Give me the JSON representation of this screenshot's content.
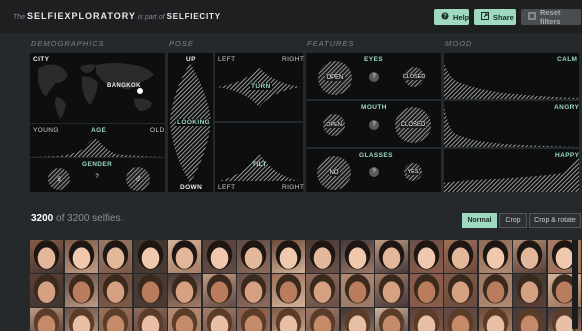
{
  "app": {
    "prefix": "The",
    "name": "SELFIEXPLORATORY",
    "part_of": "is part of",
    "city": "SELFIECITY"
  },
  "toolbar": {
    "help": "Help",
    "share": "Share",
    "reset": "Reset filters",
    "help_icon": "question-circle-icon",
    "share_icon": "share-icon",
    "reset_icon": "close-box-icon"
  },
  "sections": {
    "demographics": "DEMOGRAPHICS",
    "pose": "POSE",
    "features": "FEATURES",
    "mood": "MOOD"
  },
  "demographics": {
    "city_label": "CITY",
    "selected_city": "BANGKOK",
    "age_label": "AGE",
    "age_young": "YOUNG",
    "age_old": "OLD",
    "gender_label": "GENDER",
    "gender_female_icon": "♀",
    "gender_unknown": "?",
    "gender_male_icon": "♂"
  },
  "pose": {
    "up": "UP",
    "looking": "LOOKING",
    "down": "DOWN",
    "left": "LEFT",
    "right": "RIGHT",
    "turn": "TURN",
    "tilt": "TILT",
    "left2": "LEFT",
    "right2": "RIGHT"
  },
  "features": {
    "eyes": {
      "label": "EYES",
      "a": "OPEN",
      "q": "?",
      "b": "CLOSED"
    },
    "mouth": {
      "label": "MOUTH",
      "a": "OPEN",
      "q": "?",
      "b": "CLOSED"
    },
    "glasses": {
      "label": "GLASSES",
      "a": "NO",
      "q": "?",
      "b": "YES"
    }
  },
  "mood": {
    "calm": "CALM",
    "angry": "ANGRY",
    "happy": "HAPPY"
  },
  "results": {
    "count": "3200",
    "of_text": "of 3200 selfies."
  },
  "view_modes": {
    "normal": "Normal",
    "crop": "Crop",
    "crop_rotate": "Crop & rotate"
  },
  "colors": {
    "accent": "#9fd9c0",
    "background": "#26292c",
    "panel": "#0d0e0f"
  }
}
